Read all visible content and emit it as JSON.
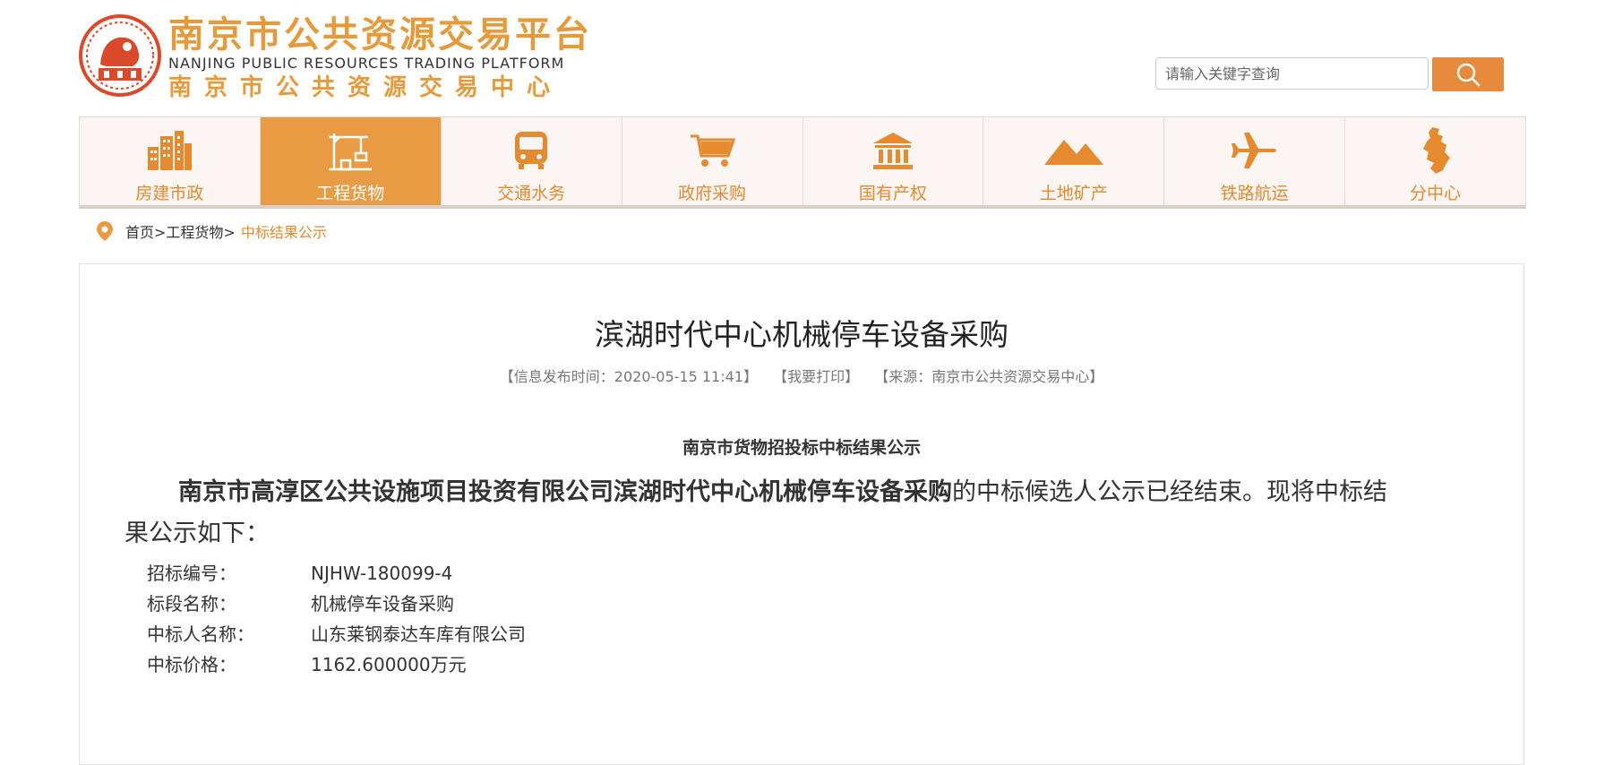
{
  "header": {
    "logo_cn": "南京市公共资源交易平台",
    "logo_en": "NANJING PUBLIC RESOURCES TRADING PLATFORM",
    "logo_cn_sub": "南京市公共资源交易中心",
    "brand_color": "#e69a3b"
  },
  "search": {
    "placeholder": "请输入关键字查询",
    "button_icon": "search-icon"
  },
  "nav": {
    "items": [
      {
        "label": "房建市政",
        "icon": "buildings-icon"
      },
      {
        "label": "工程货物",
        "icon": "crane-icon",
        "active": true
      },
      {
        "label": "交通水务",
        "icon": "bus-icon"
      },
      {
        "label": "政府采购",
        "icon": "cart-icon"
      },
      {
        "label": "国有产权",
        "icon": "bank-icon"
      },
      {
        "label": "土地矿产",
        "icon": "mountain-icon"
      },
      {
        "label": "铁路航运",
        "icon": "airplane-icon"
      },
      {
        "label": "分中心",
        "icon": "map-icon"
      }
    ],
    "active_color": "#e99b43"
  },
  "breadcrumb": {
    "icon": "location-pin-icon",
    "home": "首页>",
    "section": "工程货物>",
    "current": "中标结果公示"
  },
  "article": {
    "title": "滨湖时代中心机械停车设备采购",
    "meta": {
      "publish_time": "【信息发布时间：2020-05-15 11:41】",
      "print": "【我要打印】",
      "source": "【来源：南京市公共资源交易中心】"
    },
    "notice_heading": "南京市货物招投标中标结果公示",
    "intro_bold": "南京市高淳区公共设施项目投资有限公司滨湖时代中心机械停车设备采购",
    "intro_rest": "的中标候选人公示已经结束。现将中标结果公示如下：",
    "fields": [
      {
        "label": "招标编号：",
        "value": "NJHW-180099-4"
      },
      {
        "label": "标段名称：",
        "value": "机械停车设备采购"
      },
      {
        "label": "中标人名称：",
        "value": "山东莱钢泰达车库有限公司"
      },
      {
        "label": "中标价格：",
        "value": "1162.600000万元"
      }
    ]
  }
}
